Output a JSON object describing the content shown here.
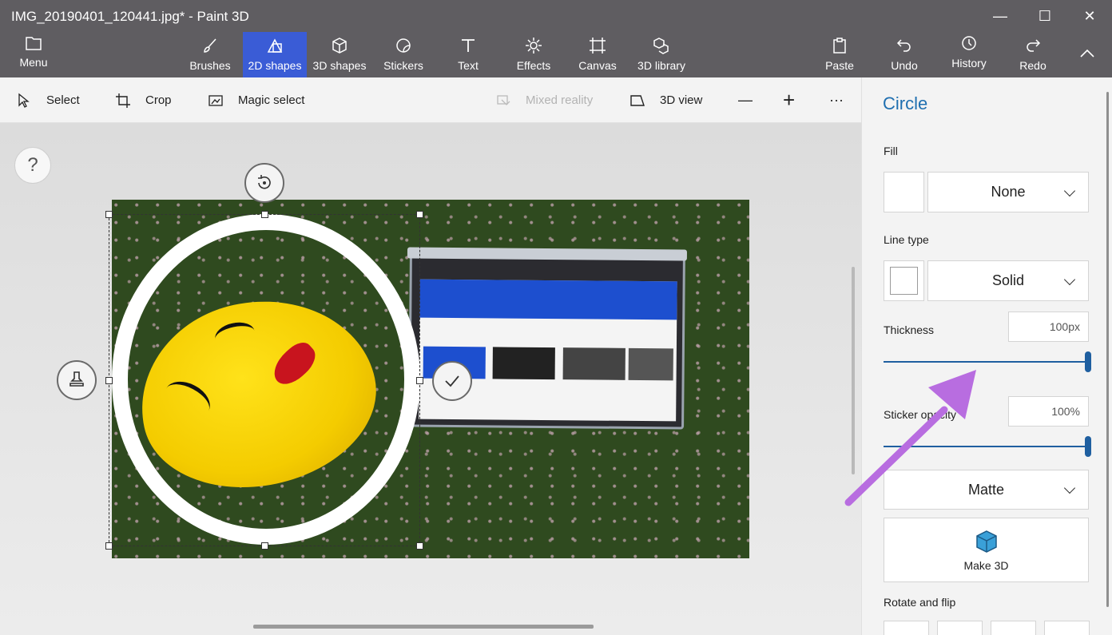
{
  "window": {
    "title": "IMG_20190401_120441.jpg* - Paint 3D",
    "minimize_glyph": "—",
    "maximize_glyph": "☐",
    "close_glyph": "✕"
  },
  "ribbon": {
    "menu_label": "Menu",
    "tools": [
      {
        "label": "Brushes",
        "icon": "brush-icon"
      },
      {
        "label": "2D shapes",
        "icon": "2d-shapes-icon",
        "active": true
      },
      {
        "label": "3D shapes",
        "icon": "3d-shapes-icon"
      },
      {
        "label": "Stickers",
        "icon": "sticker-icon"
      },
      {
        "label": "Text",
        "icon": "text-icon"
      },
      {
        "label": "Effects",
        "icon": "effects-icon"
      },
      {
        "label": "Canvas",
        "icon": "canvas-icon"
      },
      {
        "label": "3D library",
        "icon": "3d-library-icon"
      }
    ],
    "right_tools": [
      {
        "label": "Paste",
        "icon": "paste-icon"
      },
      {
        "label": "Undo",
        "icon": "undo-icon"
      },
      {
        "label": "History",
        "icon": "history-icon"
      },
      {
        "label": "Redo",
        "icon": "redo-icon"
      }
    ],
    "active_color": "#3a5cd6"
  },
  "subtoolbar": {
    "select": "Select",
    "crop": "Crop",
    "magic_select": "Magic select",
    "mixed_reality": "Mixed reality",
    "view_3d": "3D view",
    "zoom_out_glyph": "—",
    "zoom_in_glyph": "+",
    "more_glyph": "···"
  },
  "canvas": {
    "help_glyph": "?"
  },
  "panel": {
    "title": "Circle",
    "fill_label": "Fill",
    "fill_value": "None",
    "line_type_label": "Line type",
    "line_type_value": "Solid",
    "thickness_label": "Thickness",
    "thickness_value": "100px",
    "sticker_opacity_label": "Sticker opacity",
    "sticker_opacity_value": "100%",
    "finish_value": "Matte",
    "make3d_label": "Make 3D",
    "rotate_flip_label": "Rotate and flip",
    "accent_color": "#1f6fb0"
  }
}
